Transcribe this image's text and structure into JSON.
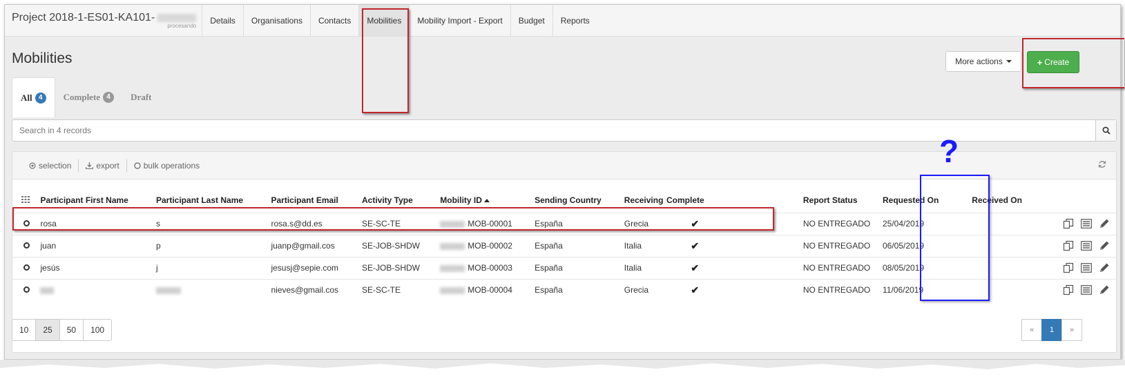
{
  "nav": {
    "project_title": "Project 2018-1-ES01-KA101-",
    "project_sub": "procesando",
    "tabs": [
      "Details",
      "Organisations",
      "Contacts",
      "Mobilities",
      "Mobility Import - Export",
      "Budget",
      "Reports"
    ],
    "active_tab": "Mobilities"
  },
  "page": {
    "title": "Mobilities",
    "more_actions": "More actions",
    "create": "Create"
  },
  "subtabs": [
    {
      "label": "All",
      "count": "4"
    },
    {
      "label": "Complete",
      "count": "4"
    },
    {
      "label": "Draft",
      "count": ""
    }
  ],
  "search": {
    "placeholder": "Search in 4 records"
  },
  "toolbar": {
    "selection": "selection",
    "export": "export",
    "bulk": "bulk operations"
  },
  "table": {
    "columns": [
      "Participant First Name",
      "Participant Last Name",
      "Participant Email",
      "Activity Type",
      "Mobility ID",
      "Sending Country",
      "Receiving",
      "Complete",
      "Report Status",
      "Requested On",
      "Received On"
    ],
    "rows": [
      {
        "first": "rosa",
        "last": "s",
        "email": "rosa.s@dd.es",
        "activity": "SE-SC-TE",
        "mobility_id": "MOB-00001",
        "sending": "España",
        "receiving": "Grecia",
        "complete": "✔",
        "report": "NO ENTREGADO",
        "requested": "25/04/2019",
        "received": ""
      },
      {
        "first": "juan",
        "last": "p",
        "email": "juanp@gmail.cos",
        "activity": "SE-JOB-SHDW",
        "mobility_id": "MOB-00002",
        "sending": "España",
        "receiving": "Italia",
        "complete": "✔",
        "report": "NO ENTREGADO",
        "requested": "06/05/2019",
        "received": ""
      },
      {
        "first": "jesús",
        "last": "j",
        "email": "jesusj@sepie.com",
        "activity": "SE-JOB-SHDW",
        "mobility_id": "MOB-00003",
        "sending": "España",
        "receiving": "Italia",
        "complete": "✔",
        "report": "NO ENTREGADO",
        "requested": "08/05/2019",
        "received": ""
      },
      {
        "first": "",
        "last": "",
        "email": "nieves@gmail.cos",
        "activity": "SE-SC-TE",
        "mobility_id": "MOB-00004",
        "sending": "España",
        "receiving": "Grecia",
        "complete": "✔",
        "report": "NO ENTREGADO",
        "requested": "11/06/2019",
        "received": ""
      }
    ]
  },
  "pagination": {
    "sizes": [
      "10",
      "25",
      "50",
      "100"
    ],
    "active_size": "25",
    "prev": "«",
    "current": "1",
    "next": "»"
  },
  "annotation": {
    "question_mark": "?"
  },
  "colors": {
    "create_green": "#4cae4c",
    "primary_blue": "#337ab7",
    "annotation_red": "#c0272d",
    "annotation_blue": "#1a1aff"
  }
}
